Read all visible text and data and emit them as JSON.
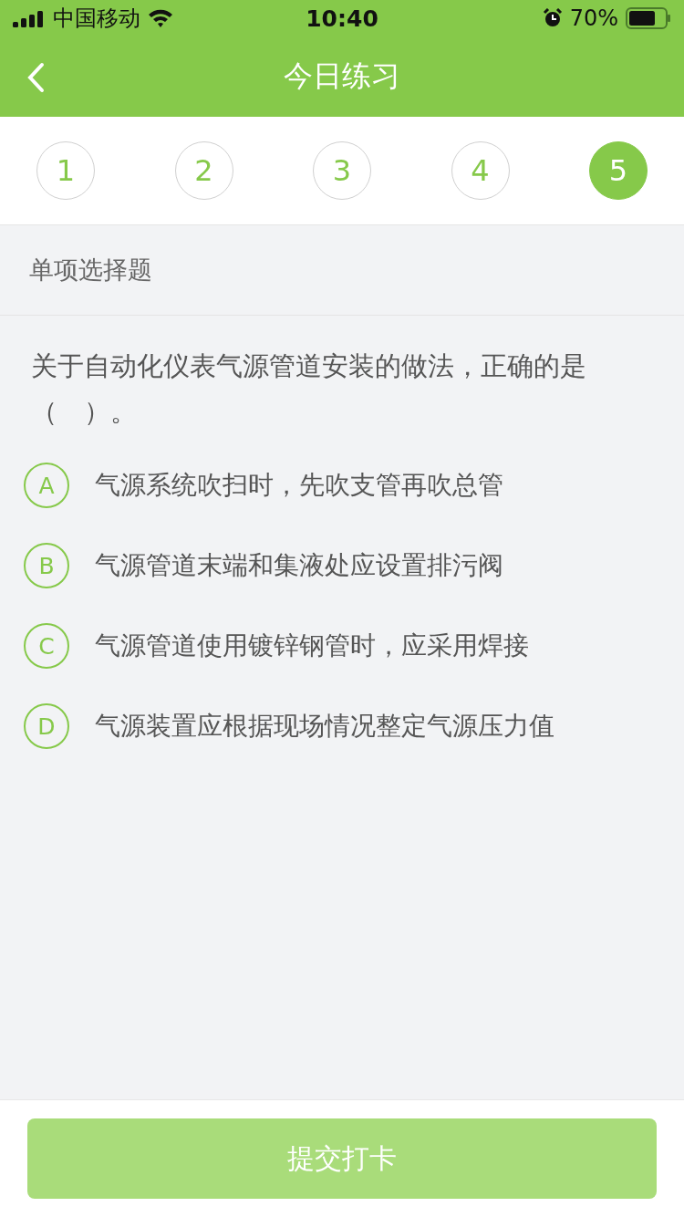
{
  "status_bar": {
    "carrier": "中国移动",
    "time": "10:40",
    "battery": "70%"
  },
  "nav": {
    "title": "今日练习"
  },
  "steps": [
    {
      "label": "1",
      "selected": false
    },
    {
      "label": "2",
      "selected": false
    },
    {
      "label": "3",
      "selected": false
    },
    {
      "label": "4",
      "selected": false
    },
    {
      "label": "5",
      "selected": true
    }
  ],
  "question": {
    "type": "单项选择题",
    "text": "关于自动化仪表气源管道安装的做法，正确的是（　）。"
  },
  "options": [
    {
      "letter": "A",
      "text": "气源系统吹扫时，先吹支管再吹总管",
      "selected": false
    },
    {
      "letter": "B",
      "text": "气源管道末端和集液处应设置排污阀",
      "selected": false
    },
    {
      "letter": "C",
      "text": "气源管道使用镀锌钢管时，应采用焊接",
      "selected": false
    },
    {
      "letter": "D",
      "text": "气源装置应根据现场情况整定气源压力值",
      "selected": false
    }
  ],
  "submit": {
    "label": "提交打卡",
    "disabled": true
  }
}
